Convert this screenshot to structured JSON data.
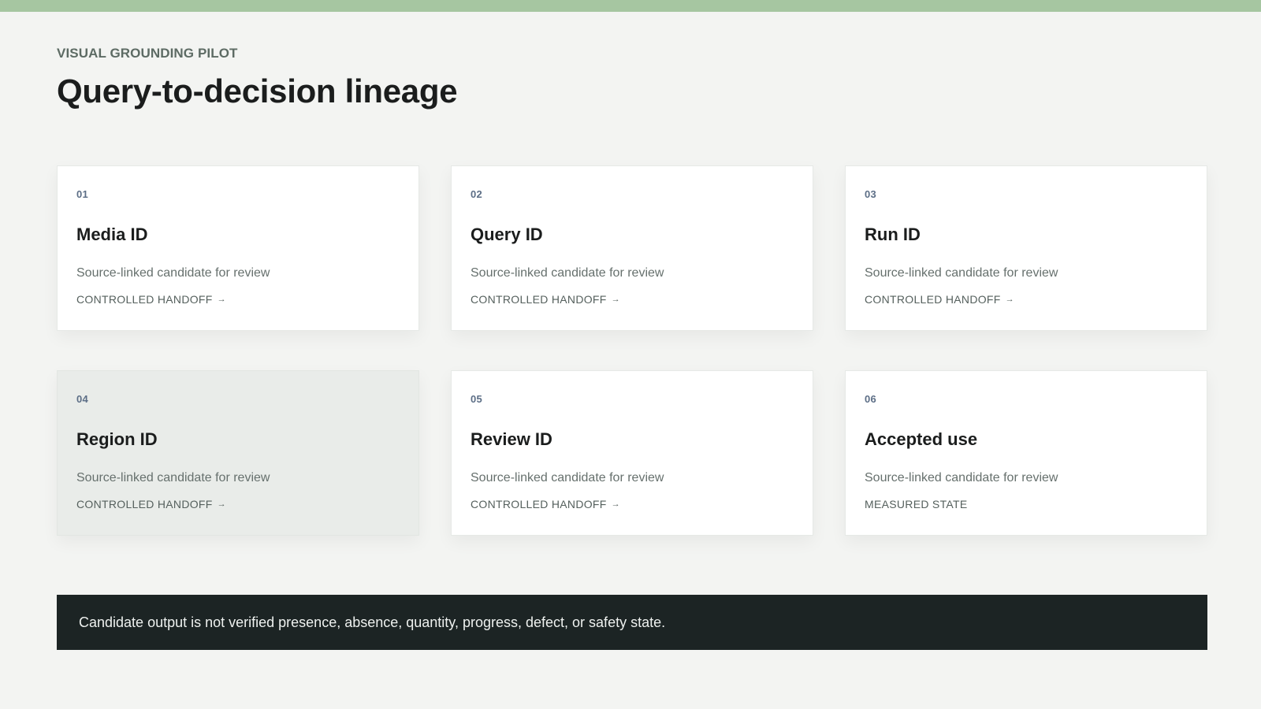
{
  "header": {
    "eyebrow": "VISUAL GROUNDING PILOT",
    "title": "Query-to-decision lineage"
  },
  "cards": [
    {
      "number": "01",
      "title": "Media ID",
      "description": "Source-linked candidate for review",
      "tag": "CONTROLLED HANDOFF",
      "arrow": "→"
    },
    {
      "number": "02",
      "title": "Query ID",
      "description": "Source-linked candidate for review",
      "tag": "CONTROLLED HANDOFF",
      "arrow": "→"
    },
    {
      "number": "03",
      "title": "Run ID",
      "description": "Source-linked candidate for review",
      "tag": "CONTROLLED HANDOFF",
      "arrow": "→"
    },
    {
      "number": "04",
      "title": "Region ID",
      "description": "Source-linked candidate for review",
      "tag": "CONTROLLED HANDOFF",
      "arrow": "→"
    },
    {
      "number": "05",
      "title": "Review ID",
      "description": "Source-linked candidate for review",
      "tag": "CONTROLLED HANDOFF",
      "arrow": "→"
    },
    {
      "number": "06",
      "title": "Accepted use",
      "description": "Source-linked candidate for review",
      "tag": "MEASURED STATE",
      "arrow": ""
    }
  ],
  "footer": {
    "note": "Candidate output is not verified presence, absence, quantity, progress, defect, or safety state."
  },
  "colors": {
    "top_bar": "#a6c6a1",
    "background": "#f3f4f2",
    "footer_bg": "#1c2424",
    "card_number": "#5c6e86"
  },
  "icons": {
    "arrow": "right-arrow-icon"
  }
}
